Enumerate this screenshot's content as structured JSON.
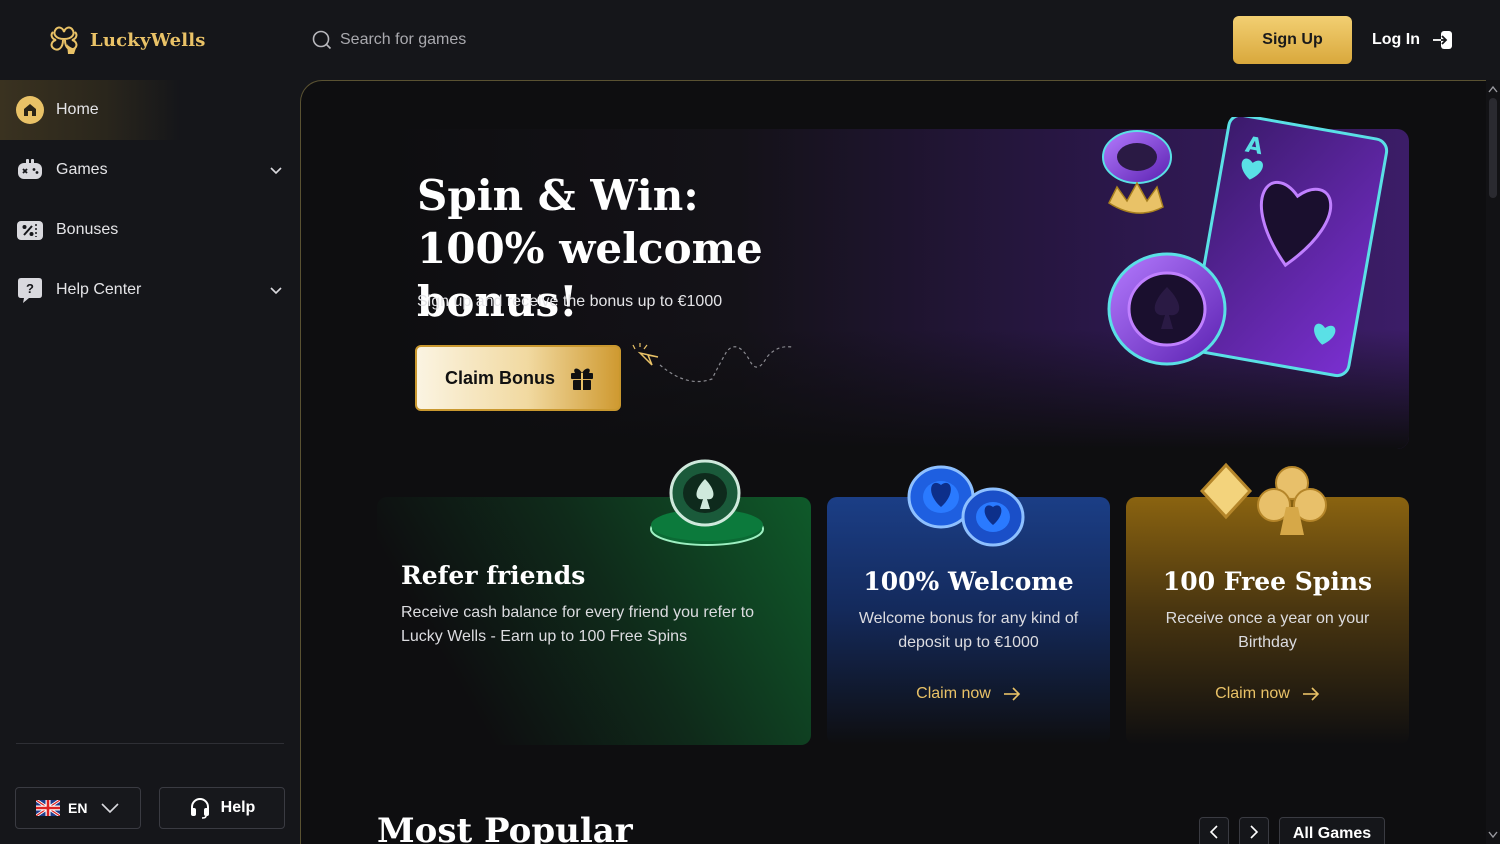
{
  "brand": {
    "name": "LuckyWells",
    "accent": "#e9c267"
  },
  "header": {
    "search_placeholder": "Search for games",
    "signup_label": "Sign Up",
    "login_label": "Log In"
  },
  "sidebar": {
    "items": [
      {
        "label": "Home",
        "icon": "home-icon",
        "active": true
      },
      {
        "label": "Games",
        "icon": "gamepad-icon",
        "has_submenu": true
      },
      {
        "label": "Bonuses",
        "icon": "percent-ticket-icon"
      },
      {
        "label": "Help Center",
        "icon": "question-bubble-icon",
        "has_submenu": true
      }
    ],
    "language": "EN",
    "help_label": "Help"
  },
  "hero": {
    "title_line1": "Spin & Win:",
    "title_line2": "100% welcome bonus!",
    "subtitle": "Sign up and receive the bonus up to €1000",
    "cta_label": "Claim Bonus"
  },
  "promos": [
    {
      "title": "Refer friends",
      "description": "Receive cash balance for every friend you refer to Lucky Wells - Earn up to 100 Free Spins",
      "color": "#0f5a2a"
    },
    {
      "title": "100% Welcome",
      "description": "Welcome bonus for any kind of deposit up to €1000",
      "link": "Claim now",
      "color": "#1b3e86"
    },
    {
      "title": "100 Free Spins",
      "description": "Receive once a year on your Birthday",
      "link": "Claim now",
      "color": "#8a6310"
    }
  ],
  "popular": {
    "title": "Most Popular",
    "all_games_label": "All Games"
  }
}
